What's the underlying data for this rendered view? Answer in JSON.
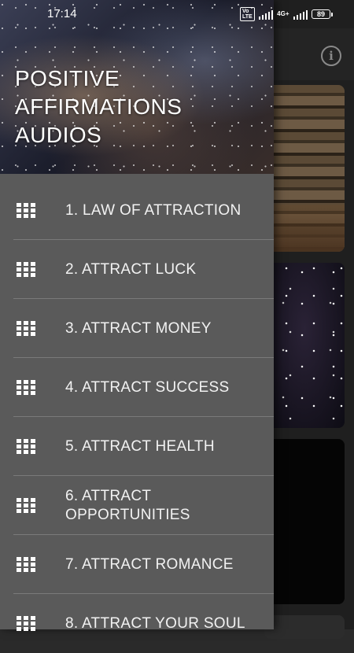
{
  "status_bar": {
    "time": "17:14",
    "volte": "Vo\nLTE",
    "network": "4G+",
    "battery": "89"
  },
  "drawer": {
    "title": "POSITIVE AFFIRMATIONS AUDIOS",
    "items": [
      {
        "label": "1. LAW OF ATTRACTION",
        "icon": "grid-icon"
      },
      {
        "label": "2. ATTRACT LUCK",
        "icon": "grid-icon"
      },
      {
        "label": "3. ATTRACT MONEY",
        "icon": "grid-icon"
      },
      {
        "label": "4. ATTRACT SUCCESS",
        "icon": "grid-icon"
      },
      {
        "label": "5. ATTRACT HEALTH",
        "icon": "grid-icon"
      },
      {
        "label": "6. ATTRACT OPPORTUNITIES",
        "icon": "grid-icon"
      },
      {
        "label": "7. ATTRACT ROMANCE",
        "icon": "grid-icon"
      },
      {
        "label": "8. ATTRACT YOUR SOUL",
        "icon": "grid-icon"
      }
    ]
  },
  "toolbar": {
    "info_icon": "info-icon",
    "info_glyph": "i"
  },
  "colors": {
    "drawer_bg": "#5a5a5a",
    "divider": "#7a7a7a",
    "text": "#f2f2f2"
  }
}
